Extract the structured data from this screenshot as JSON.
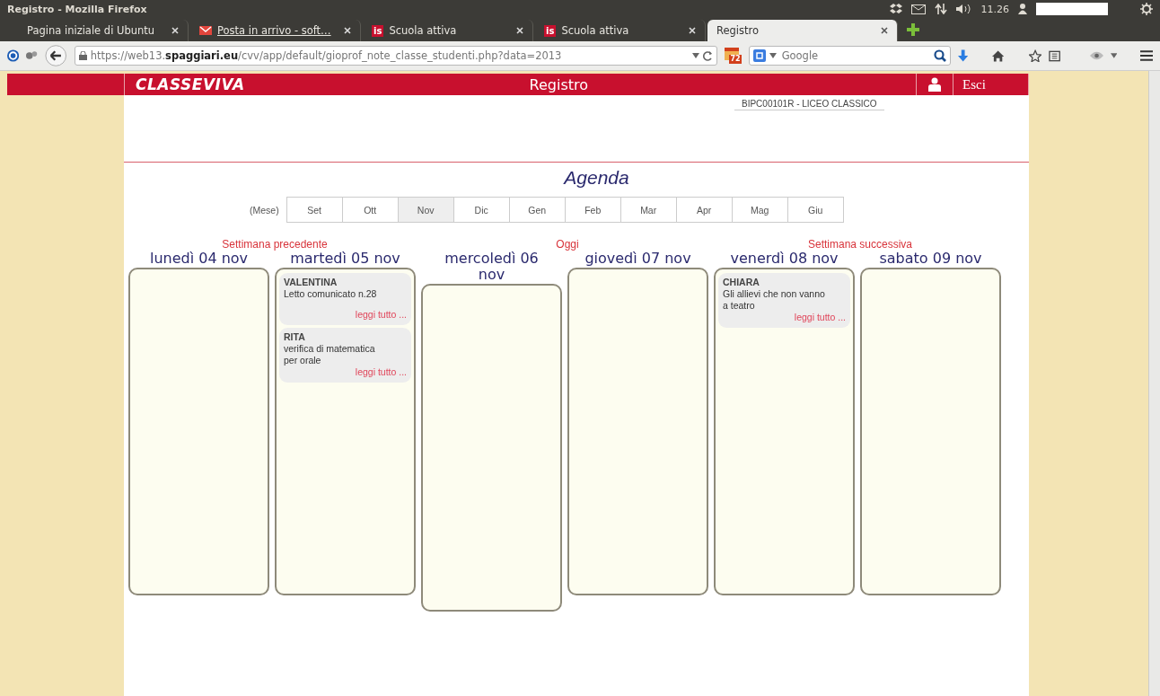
{
  "window": {
    "title": "Registro - Mozilla Firefox"
  },
  "system_tray": {
    "clock": "11.26"
  },
  "tabs": [
    {
      "label": "Pagina iniziale di Ubuntu",
      "kind": "plain",
      "selected": false
    },
    {
      "label": "Posta in arrivo - soft…",
      "kind": "mail",
      "selected": false
    },
    {
      "label": "Scuola attiva",
      "kind": "site",
      "icon_text": "is",
      "selected": false
    },
    {
      "label": "Scuola attiva",
      "kind": "site",
      "icon_text": "is",
      "selected": false
    },
    {
      "label": "Registro",
      "kind": "plain",
      "selected": true
    }
  ],
  "address_bar": {
    "url": "https://web13.**spaggiari.eu**/cvv/app/default/gioprof_note_classe_studenti.php?data=2013"
  },
  "addon_badge": "72",
  "search_field": {
    "placeholder": "Google"
  },
  "header": {
    "logo": "CLASSEVIVA",
    "title": "Registro",
    "logout": "Esci",
    "school": "BIPC00101R - LICEO CLASSICO"
  },
  "agenda": {
    "title": "Agenda",
    "months": {
      "label": "(Mese)",
      "items": [
        {
          "label": "Set",
          "selected": false
        },
        {
          "label": "Ott",
          "selected": false
        },
        {
          "label": "Nov",
          "selected": true
        },
        {
          "label": "Dic",
          "selected": false
        },
        {
          "label": "Gen",
          "selected": false
        },
        {
          "label": "Feb",
          "selected": false
        },
        {
          "label": "Mar",
          "selected": false
        },
        {
          "label": "Apr",
          "selected": false
        },
        {
          "label": "Mag",
          "selected": false
        },
        {
          "label": "Giu",
          "selected": false
        }
      ]
    },
    "week_nav": [
      "Settimana precedente",
      "Oggi",
      "Settimana successiva"
    ],
    "days": [
      {
        "label": "lunedì 04 nov"
      },
      {
        "label": "martedì 05 nov",
        "notes": [
          {
            "author": "VALENTINA",
            "text": "Letto comunicato n.28",
            "link": "leggi tutto ..."
          },
          {
            "author": "RITA",
            "text": "verifica di matematica per orale",
            "link": "leggi tutto ..."
          }
        ]
      },
      {
        "label": "mercoledì 06 nov"
      },
      {
        "label": "giovedì 07 nov"
      },
      {
        "label": "venerdì 08 nov",
        "notes": [
          {
            "author": "CHIARA",
            "text": "Gli allievi che non vanno a teatro",
            "link": "leggi tutto ..."
          }
        ]
      },
      {
        "label": "sabato 09 nov"
      }
    ]
  }
}
